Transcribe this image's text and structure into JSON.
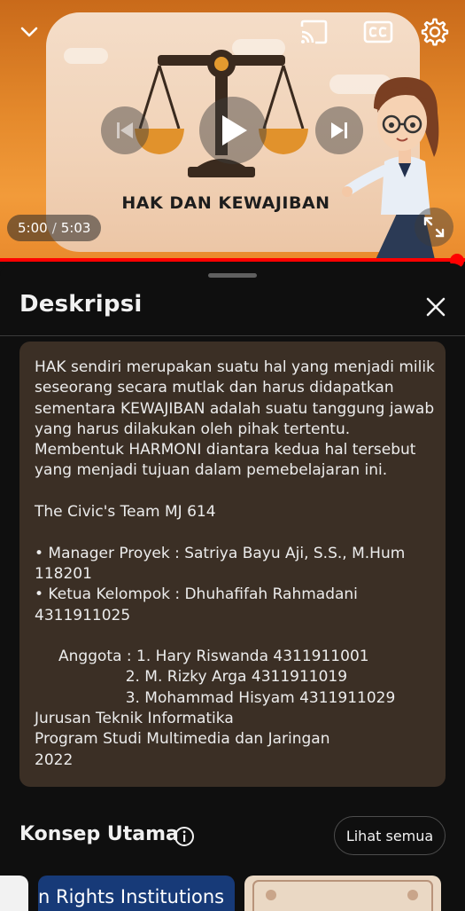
{
  "player": {
    "video_title_art": "HAK DAN KEWAJIBAN",
    "time_current": "5:00",
    "time_separator": "/",
    "time_total": "5:03",
    "progress_fraction": 0.99,
    "icons": {
      "collapse": "chevron-down-icon",
      "cast": "cast-icon",
      "captions": "captions-icon",
      "settings": "gear-icon",
      "previous": "skip-previous-icon",
      "play": "play-icon",
      "next": "skip-next-icon",
      "fullscreen": "fullscreen-icon"
    },
    "accent_color": "#ff0000"
  },
  "sheet": {
    "title": "Deskripsi",
    "close_icon": "close-icon",
    "description_color": "#3b2f25",
    "description_paragraphs": [
      "HAK sendiri merupakan suatu hal yang menjadi milik seseorang secara mutlak dan harus didapatkan sementara KEWAJIBAN adalah suatu tanggung jawab yang harus dilakukan oleh pihak tertentu. Membentuk HARMONI diantara kedua hal tersebut yang menjadi tujuan dalam pemebelajaran ini.",
      "The Civic's Team MJ 614",
      "• Manager Proyek : Satriya Bayu Aji, S.S., M.Hum 118201\n• Ketua Kelompok : Dhuhafifah Rahmadani 4311911025",
      "     Anggota : 1. Hary Riswanda 4311911001\n                   2. M. Rizky Arga 4311911019\n                   3. Mohammad Hisyam 4311911029\nJurusan Teknik Informatika\nProgram Studi Multimedia dan Jaringan\n2022"
    ]
  },
  "key_concepts": {
    "title": "Konsep Utama",
    "info_icon": "info-icon",
    "see_all_label": "Lihat semua",
    "cards": [
      {
        "caption": ""
      },
      {
        "caption": "n Rights Institutions"
      },
      {
        "caption": ""
      }
    ]
  }
}
